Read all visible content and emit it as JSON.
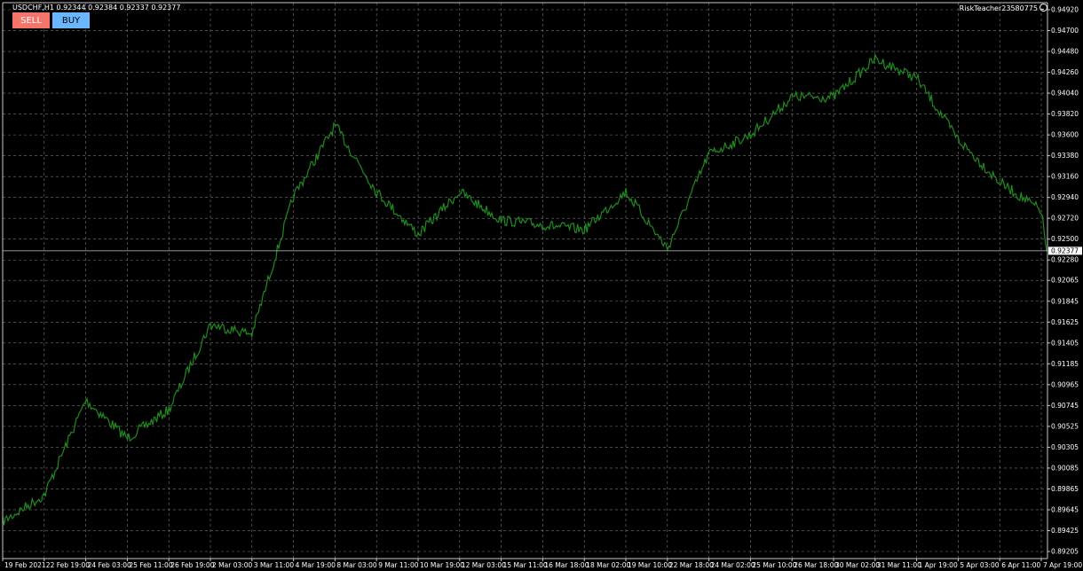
{
  "header": {
    "symbol_info": "USDCHF,H1  0.92344 0.92384 0.92337 0.92377",
    "account": "RiskTeacher23580775",
    "account_icon": "smile-icon"
  },
  "trade_buttons": {
    "sell_label": "SELL",
    "buy_label": "BUY",
    "sell_color": "#f5756b",
    "buy_color": "#6ab7ff"
  },
  "colors": {
    "background": "#000000",
    "grid": "#7a7a7a",
    "series": "#1e8c1e",
    "axis_text": "#ffffff"
  },
  "chart_data": {
    "type": "line",
    "title": "",
    "xlabel": "",
    "ylabel": "",
    "ylim": [
      0.89205,
      0.9492
    ],
    "grid": true,
    "y_ticks": [
      "0.94920",
      "0.94700",
      "0.94480",
      "0.94260",
      "0.94040",
      "0.93820",
      "0.93600",
      "0.93380",
      "0.93160",
      "0.92940",
      "0.92720",
      "0.92500",
      "0.92280",
      "0.92065",
      "0.91845",
      "0.91625",
      "0.91405",
      "0.91185",
      "0.90965",
      "0.90745",
      "0.90525",
      "0.90305",
      "0.90085",
      "0.89865",
      "0.89645",
      "0.89425",
      "0.89205"
    ],
    "x_ticks": [
      "19 Feb 2021",
      "22 Feb 19:00",
      "24 Feb 03:00",
      "25 Feb 11:00",
      "26 Feb 19:00",
      "2 Mar 03:00",
      "3 Mar 11:00",
      "4 Mar 19:00",
      "8 Mar 03:00",
      "9 Mar 11:00",
      "10 Mar 19:00",
      "12 Mar 03:00",
      "15 Mar 11:00",
      "16 Mar 18:00",
      "18 Mar 02:00",
      "19 Mar 10:00",
      "22 Mar 18:00",
      "24 Mar 02:00",
      "25 Mar 10:00",
      "26 Mar 18:00",
      "30 Mar 02:00",
      "31 Mar 11:00",
      "1 Apr 19:00",
      "5 Apr 03:00",
      "6 Apr 11:00",
      "7 Apr 19:00"
    ],
    "current_price": "0.92377",
    "current_value": 0.92377,
    "series": [
      {
        "x": [
          "19 Feb 2021",
          "22 Feb 19:00",
          "24 Feb 03:00",
          "25 Feb 11:00",
          "26 Feb 19:00",
          "2 Mar 03:00",
          "3 Mar 11:00",
          "4 Mar 19:00",
          "8 Mar 03:00",
          "9 Mar 11:00",
          "10 Mar 19:00",
          "12 Mar 03:00",
          "15 Mar 11:00",
          "16 Mar 18:00",
          "18 Mar 02:00",
          "19 Mar 10:00",
          "22 Mar 18:00",
          "24 Mar 02:00",
          "25 Mar 10:00",
          "26 Mar 18:00",
          "30 Mar 02:00",
          "31 Mar 11:00",
          "1 Apr 19:00",
          "5 Apr 03:00",
          "6 Apr 11:00",
          "7 Apr 19:00"
        ],
        "values": [
          0.8952,
          0.898,
          0.908,
          0.904,
          0.907,
          0.916,
          0.915,
          0.9295,
          0.937,
          0.93,
          0.9255,
          0.93,
          0.927,
          0.9265,
          0.926,
          0.93,
          0.924,
          0.934,
          0.936,
          0.94,
          0.94,
          0.944,
          0.942,
          0.9355,
          0.931,
          0.928
        ]
      }
    ]
  }
}
